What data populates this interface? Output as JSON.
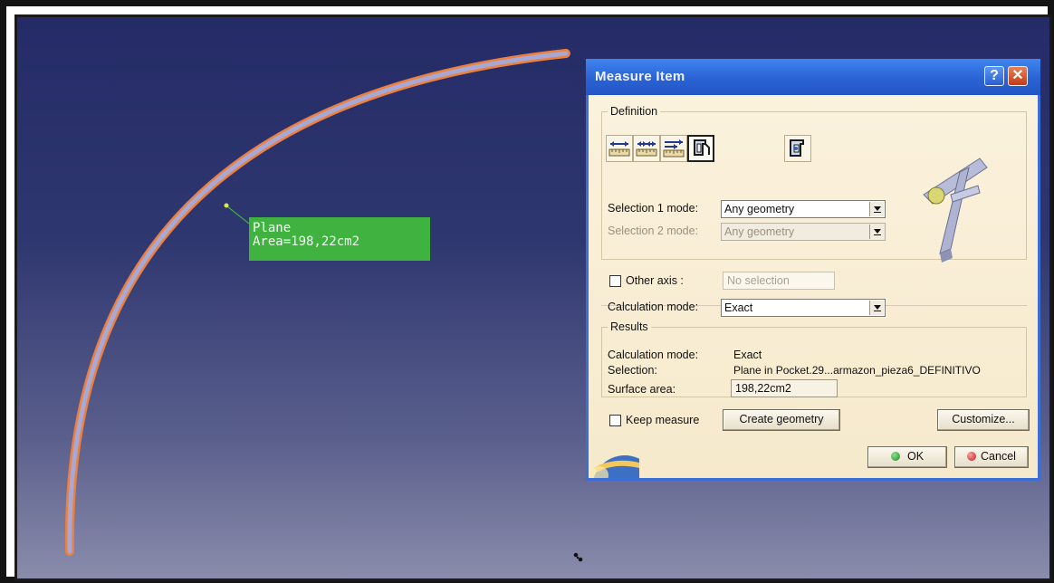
{
  "canvas": {
    "annotation": {
      "line1": "Plane",
      "line2": "Area=198,22cm2"
    }
  },
  "dialog": {
    "title": "Measure Item",
    "help_label": "?",
    "close_label": "✕",
    "definition": {
      "legend": "Definition",
      "tools": [
        "measure-between-icon",
        "measure-in-chain-icon",
        "measure-from-origin-icon",
        "measure-item-icon",
        "measure-thickness-icon"
      ],
      "selected_tool_index": 3,
      "selection1_label": "Selection 1 mode:",
      "selection1_value": "Any geometry",
      "selection2_label": "Selection 2 mode:",
      "selection2_value": "Any geometry",
      "other_axis_label": "Other axis :",
      "other_axis_checked": false,
      "other_axis_value": "No selection",
      "calc_mode_label": "Calculation mode:",
      "calc_mode_value": "Exact"
    },
    "results": {
      "legend": "Results",
      "calc_mode_label": "Calculation mode:",
      "calc_mode_value": "Exact",
      "selection_label": "Selection:",
      "selection_value": "Plane in Pocket.29...armazon_pieza6_DEFINITIVO",
      "surface_label": "Surface area:",
      "surface_value": "198,22cm2"
    },
    "keep_measure_label": "Keep measure",
    "keep_measure_checked": false,
    "create_geometry_label": "Create geometry",
    "customize_label": "Customize...",
    "ok_label": "OK",
    "cancel_label": "Cancel"
  },
  "colors": {
    "viewport_top": "#242b66",
    "viewport_bottom": "#8a8cab",
    "arc_fill": "#a7a8d4",
    "arc_outline": "#ef7f3c",
    "annotation_bg": "#3fb23f",
    "titlebar": "#2a62d4",
    "dialog_bg": "#f6ead0"
  }
}
